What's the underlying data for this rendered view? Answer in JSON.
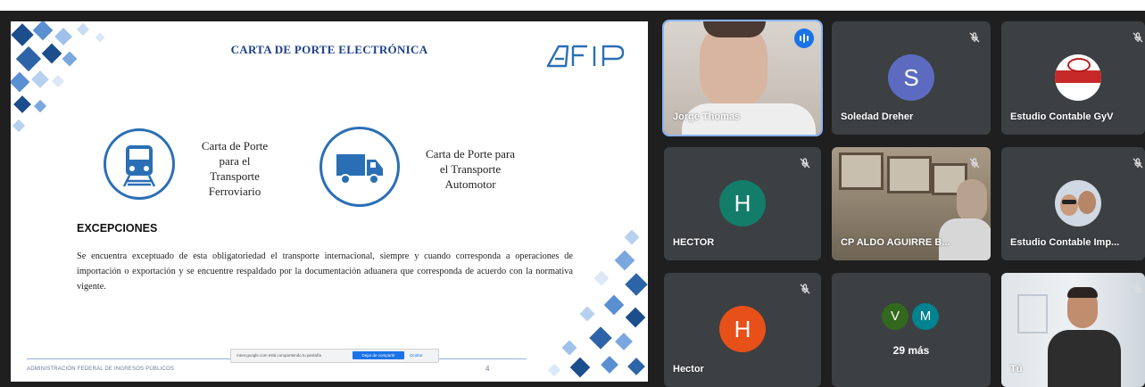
{
  "slide": {
    "title": "CARTA DE PORTE ELECTRÓNICA",
    "logo_text": "AFIP",
    "item1": {
      "icon": "train-icon",
      "lines": [
        "Carta de Porte",
        "para el",
        "Transporte",
        "Ferroviario"
      ]
    },
    "item2": {
      "icon": "truck-icon",
      "lines": [
        "Carta de Porte para",
        "el Transporte",
        "Automotor"
      ]
    },
    "exceptions_title": "EXCEPCIONES",
    "exceptions_body": "Se encuentra exceptuado de esta obligatoriedad el transporte internacional, siempre y cuando corresponda a operaciones de importación o exportación y se encuentre respaldado por la documentación aduanera que corresponda de acuerdo con la normativa vigente.",
    "footer": "ADMINISTRACIÓN FEDERAL DE INGRESOS PÚBLICOS",
    "page_number": "4",
    "share_banner": {
      "message": "meet.google.com está compartiendo tu pestaña",
      "stop_label": "Dejar de compartir",
      "hide_label": "Ocultar"
    }
  },
  "participants": [
    {
      "name": "Jorge Thomas",
      "type": "video",
      "speaking": true
    },
    {
      "name": "Soledad Dreher",
      "type": "avatar",
      "initial": "S",
      "color": "#5c6bc0",
      "muted": true
    },
    {
      "name": "Estudio Contable GyV",
      "type": "logo",
      "muted": true
    },
    {
      "name": "HECTOR",
      "type": "avatar",
      "initial": "H",
      "color": "#137d6a",
      "muted": true
    },
    {
      "name": "CP ALDO AGUIRRE B...",
      "type": "video",
      "muted": true
    },
    {
      "name": "Estudio Contable Imp...",
      "type": "photo",
      "muted": true
    },
    {
      "name": "Hector",
      "type": "avatar",
      "initial": "H",
      "color": "#e8501a",
      "muted": true
    },
    {
      "name": "29 más",
      "type": "more",
      "initials": [
        "V",
        "M"
      ],
      "colors": [
        "#33691e",
        "#00838f"
      ]
    },
    {
      "name": "Tú",
      "type": "video",
      "muted": true
    }
  ]
}
